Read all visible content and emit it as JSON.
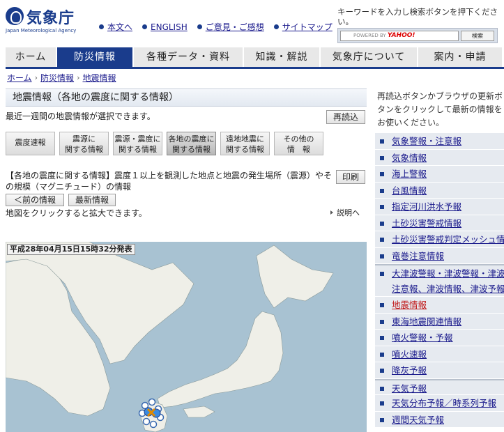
{
  "header": {
    "logo_title": "気象庁",
    "logo_subtitle": "Japan Meteorological Agency",
    "links": [
      "本文へ",
      "ENGLISH",
      "ご意見・ご感想",
      "サイトマップ"
    ],
    "search_hint": "キーワードを入力し検索ボタンを押下ください。",
    "search_placeholder_prefix": "POWERED BY",
    "search_placeholder_brand": "YAHOO!",
    "search_button": "検索"
  },
  "nav": {
    "items": [
      "ホーム",
      "防災情報",
      "各種データ・資料",
      "知識・解説",
      "気象庁について",
      "案内・申請"
    ],
    "active_index": 1,
    "active_color": "#1a3c8c"
  },
  "breadcrumb": [
    "ホーム",
    "防災情報",
    "地震情報"
  ],
  "main": {
    "title": "地震情報（各地の震度に関する情報）",
    "description": "最近一週間の地震情報が選択できます。",
    "reload_label": "再読込",
    "tabs": [
      {
        "line1": "震度速報",
        "line2": ""
      },
      {
        "line1": "震源に",
        "line2": "関する情報"
      },
      {
        "line1": "震源・震度に",
        "line2": "関する情報"
      },
      {
        "line1": "各地の震度に",
        "line2": "関する情報"
      },
      {
        "line1": "遠地地震に",
        "line2": "関する情報"
      },
      {
        "line1": "その他の",
        "line2": "情　報"
      }
    ],
    "active_tab": 3,
    "info_text": "【各地の震度に関する情報】震度１以上を観測した地点と地震の発生場所（震源）やその規模（マグニチュード）の情報",
    "print_label": "印刷",
    "prev_label": "＜前の情報",
    "latest_label": "最新情報",
    "hint": "地図をクリックすると拡大できます。",
    "explanation_link": "説明へ",
    "map_label": "平成28年04月15日15時32分発表"
  },
  "sidebar": {
    "note": "再読込ボタンかブラウザの更新ボタンをクリックして最新の情報をお使いください。",
    "items": [
      {
        "label": "気象警報・注意報",
        "tall": false,
        "gap": false,
        "current": false
      },
      {
        "label": "気象情報",
        "tall": false,
        "gap": false,
        "current": false
      },
      {
        "label": "海上警報",
        "tall": false,
        "gap": false,
        "current": false
      },
      {
        "label": "台風情報",
        "tall": false,
        "gap": false,
        "current": false
      },
      {
        "label": "指定河川洪水予報",
        "tall": false,
        "gap": false,
        "current": false
      },
      {
        "label": "土砂災害警戒情報",
        "tall": false,
        "gap": false,
        "current": false
      },
      {
        "label": "土砂災害警戒判定メッシュ情報",
        "tall": false,
        "gap": false,
        "current": false
      },
      {
        "label": "竜巻注意情報",
        "tall": false,
        "gap": false,
        "current": false
      },
      {
        "label": "大津波警報・津波警報・津波注意報、津波情報、津波予報",
        "tall": true,
        "gap": true,
        "current": false
      },
      {
        "label": "地震情報",
        "tall": false,
        "gap": false,
        "current": true
      },
      {
        "label": "東海地震関連情報",
        "tall": false,
        "gap": false,
        "current": false
      },
      {
        "label": "噴火警報・予報",
        "tall": false,
        "gap": false,
        "current": false
      },
      {
        "label": "噴火速報",
        "tall": false,
        "gap": false,
        "current": false
      },
      {
        "label": "降灰予報",
        "tall": false,
        "gap": false,
        "current": false
      },
      {
        "label": "天気予報",
        "tall": false,
        "gap": true,
        "current": false
      },
      {
        "label": "天気分布予報／時系列予報",
        "tall": false,
        "gap": false,
        "current": false
      },
      {
        "label": "週間天気予報",
        "tall": false,
        "gap": false,
        "current": false
      }
    ]
  }
}
